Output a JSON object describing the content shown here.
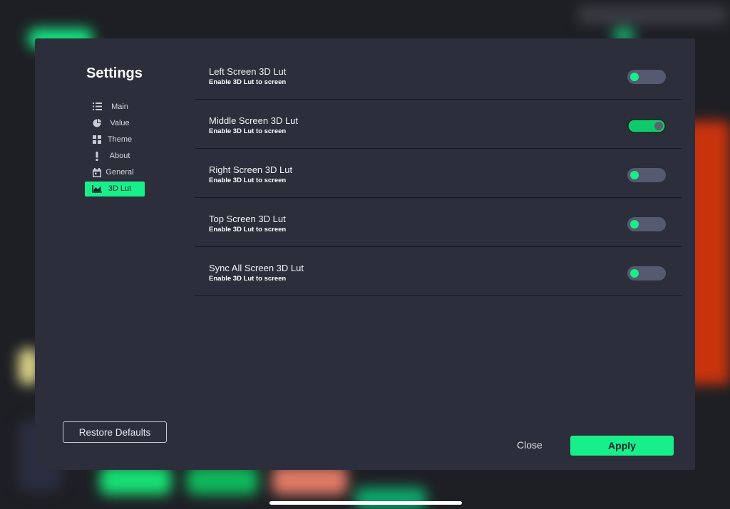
{
  "sidebar": {
    "title": "Settings",
    "items": [
      {
        "label": "Main",
        "icon": "list-icon"
      },
      {
        "label": "Value",
        "icon": "pie-chart-icon"
      },
      {
        "label": "Theme",
        "icon": "grid-icon"
      },
      {
        "label": "About",
        "icon": "exclamation-icon"
      },
      {
        "label": "General",
        "icon": "calendar-icon"
      },
      {
        "label": "3D Lut",
        "icon": "area-chart-icon",
        "active": true
      }
    ]
  },
  "settings": [
    {
      "title": "Left Screen 3D Lut",
      "subtitle": "Enable 3D Lut to screen",
      "enabled": false
    },
    {
      "title": "Middle Screen 3D Lut",
      "subtitle": "Enable 3D Lut to screen",
      "enabled": true
    },
    {
      "title": "Right Screen 3D Lut",
      "subtitle": "Enable 3D Lut to screen",
      "enabled": false
    },
    {
      "title": "Top Screen 3D Lut",
      "subtitle": "Enable 3D Lut to screen",
      "enabled": false
    },
    {
      "title": "Sync All Screen 3D Lut",
      "subtitle": "Enable 3D Lut to screen",
      "enabled": false
    }
  ],
  "footer": {
    "restore_label": "Restore Defaults",
    "close_label": "Close",
    "apply_label": "Apply"
  },
  "colors": {
    "accent": "#17f08a",
    "dialog_bg": "#2c2e3b",
    "toggle_off": "#555a70"
  }
}
